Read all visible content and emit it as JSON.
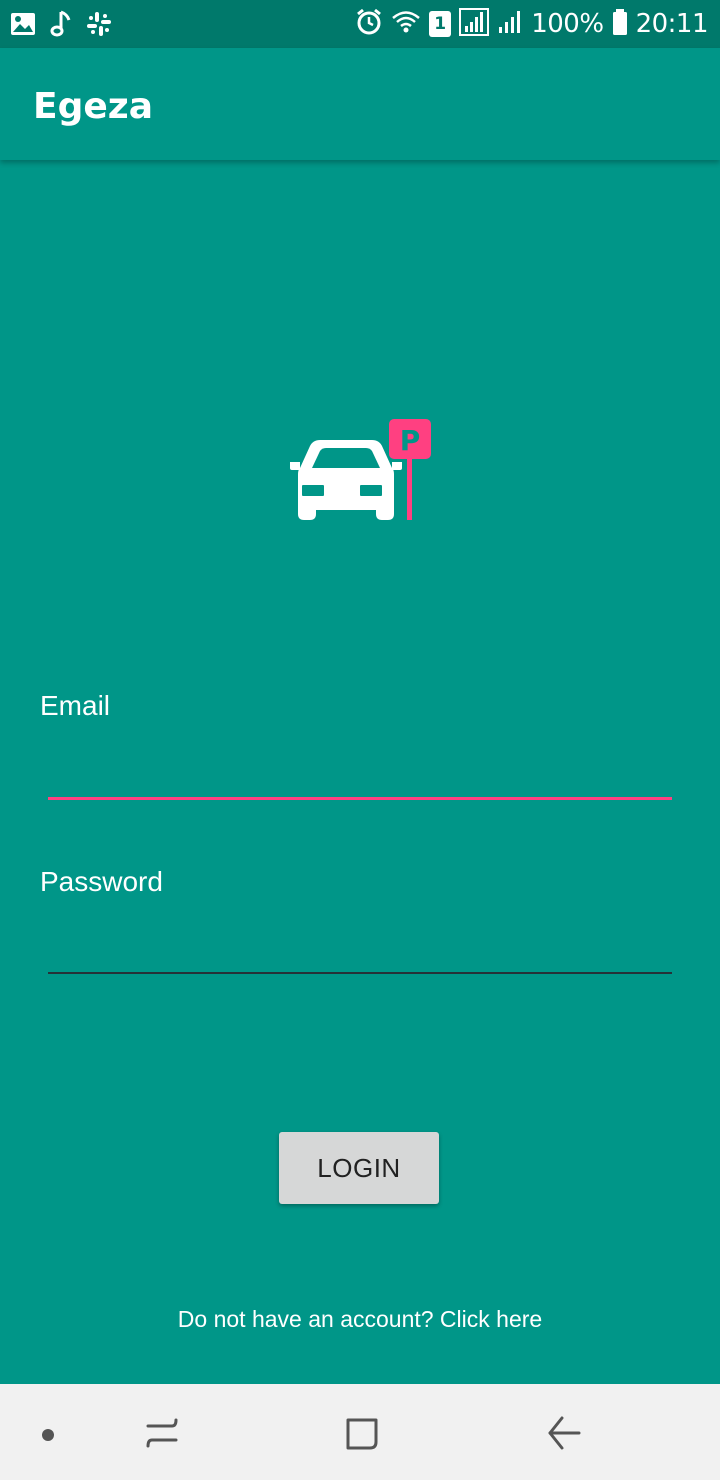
{
  "status_bar": {
    "left_icons": [
      "image-icon",
      "music-note-icon",
      "slack-icon"
    ],
    "right_icons": [
      "alarm-icon",
      "wifi-icon",
      "sim-1-icon",
      "signal-icon",
      "signal-icon",
      "battery-icon"
    ],
    "sim_number": "1",
    "battery": "100%",
    "time": "20:11"
  },
  "app_bar": {
    "title": "Egeza"
  },
  "logo": {
    "icon": "car-parking-icon",
    "sign_letter": "P",
    "accent": "#FF4081"
  },
  "form": {
    "email_label": "Email",
    "email_value": "",
    "password_label": "Password",
    "password_value": "",
    "login_label": "LOGIN"
  },
  "signup": {
    "text": "Do not have an account? Click here"
  },
  "nav_bar": {
    "icons": [
      "dot-icon",
      "recent-apps-icon",
      "home-icon",
      "back-icon"
    ]
  },
  "colors": {
    "primary": "#009688",
    "primary_dark": "#00796B",
    "accent": "#FF4081",
    "button": "#D6D7D7",
    "nav_bar": "#F1F1F1"
  }
}
